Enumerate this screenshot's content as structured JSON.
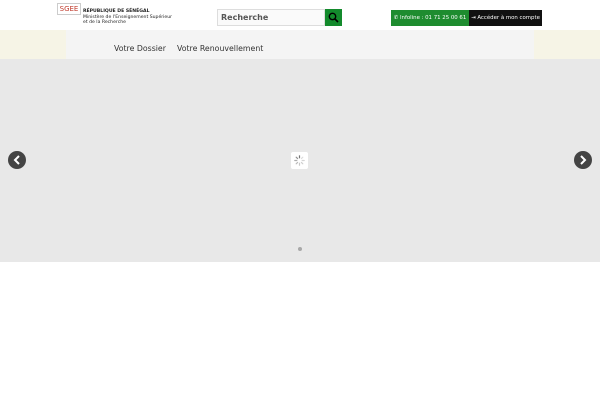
{
  "header": {
    "logo_text": "SGEE",
    "org_line1": "RÉPUBLIQUE DE SÉNÉGAL",
    "org_line2": "Ministère de l'Enseignement Supérieur",
    "org_line3": "et de la Recherche",
    "search_placeholder": "Recherche",
    "infoline": "Infoline : 01 71 25 00 61",
    "account": "Accéder à mon compte"
  },
  "nav": {
    "items": [
      "Votre Dossier",
      "Votre Renouvellement"
    ]
  },
  "slider": {
    "prev_icon": "chevron-left-icon",
    "next_icon": "chevron-right-icon",
    "loading_icon": "spinner-icon"
  },
  "colors": {
    "accent_green": "#1e8c2f",
    "dark": "#111111",
    "band": "#f6f4e6"
  }
}
